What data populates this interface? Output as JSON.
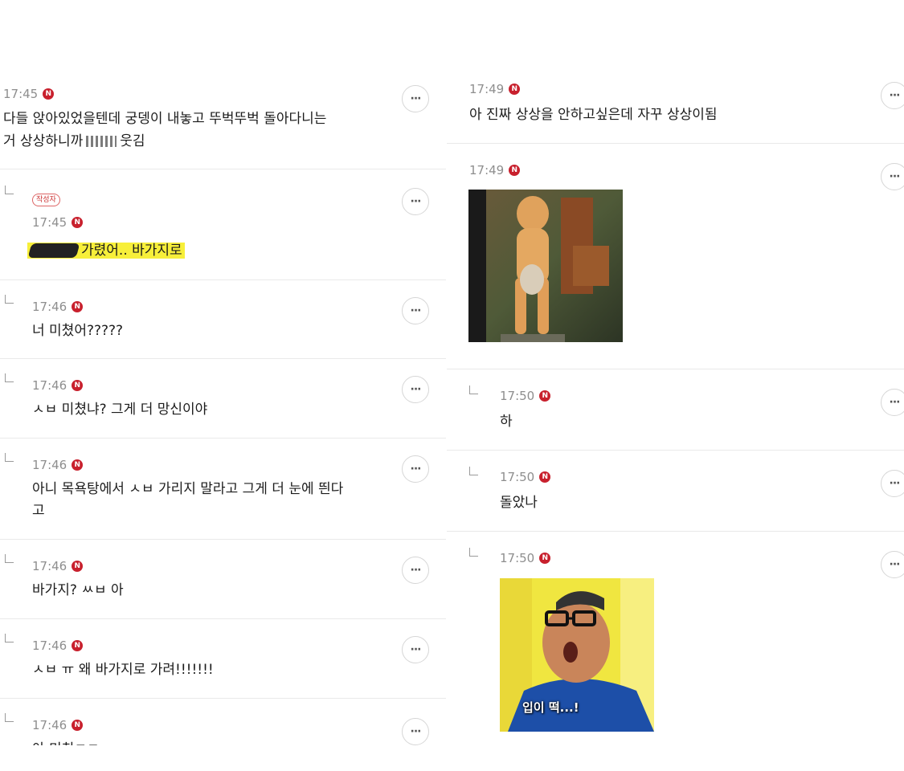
{
  "left_comments": [
    {
      "time": "17:45",
      "badge": "N",
      "text1": "다들 앉아있었을텐데 궁뎅이 내놓고 뚜벅뚜벅 돌아다니는",
      "text2": "거 상상하니까",
      "text2_tail": "웃김"
    },
    {
      "time": "17:45",
      "badge": "N",
      "author_tag": "작성자",
      "text": "가렸어.. 바가지로"
    },
    {
      "time": "17:46",
      "badge": "N",
      "text": "너 미쳤어?????"
    },
    {
      "time": "17:46",
      "badge": "N",
      "text": "ㅅㅂ 미쳤냐? 그게 더 망신이야"
    },
    {
      "time": "17:46",
      "badge": "N",
      "text1": "아니 목욕탕에서 ㅅㅂ 가리지 말라고 그게 더 눈에 띈다",
      "text2": "고"
    },
    {
      "time": "17:46",
      "badge": "N",
      "text": "바가지? ㅆㅂ 아"
    },
    {
      "time": "17:46",
      "badge": "N",
      "text": "ㅅㅂ ㅠ 왜 바가지로 가려!!!!!!!"
    },
    {
      "time": "17:46",
      "badge": "N",
      "text": "아 미친ㅋㅋ"
    }
  ],
  "right_comments": [
    {
      "time": "17:49",
      "badge": "N",
      "text": "아 진짜 상상을 안하고싶은데 자꾸 상상이됨"
    },
    {
      "time": "17:49",
      "badge": "N",
      "image": "figure-statue-covered-with-bowl"
    },
    {
      "time": "17:50",
      "badge": "N",
      "text": "하"
    },
    {
      "time": "17:50",
      "badge": "N",
      "text": "돌았나"
    },
    {
      "time": "17:50",
      "badge": "N",
      "image": "surprised-man-meme",
      "image_caption": "입이 떡...!"
    }
  ],
  "more_label": "···",
  "colors": {
    "accent": "#c8202d",
    "highlight": "#f7ef3a",
    "divider": "#e9e9e9"
  }
}
